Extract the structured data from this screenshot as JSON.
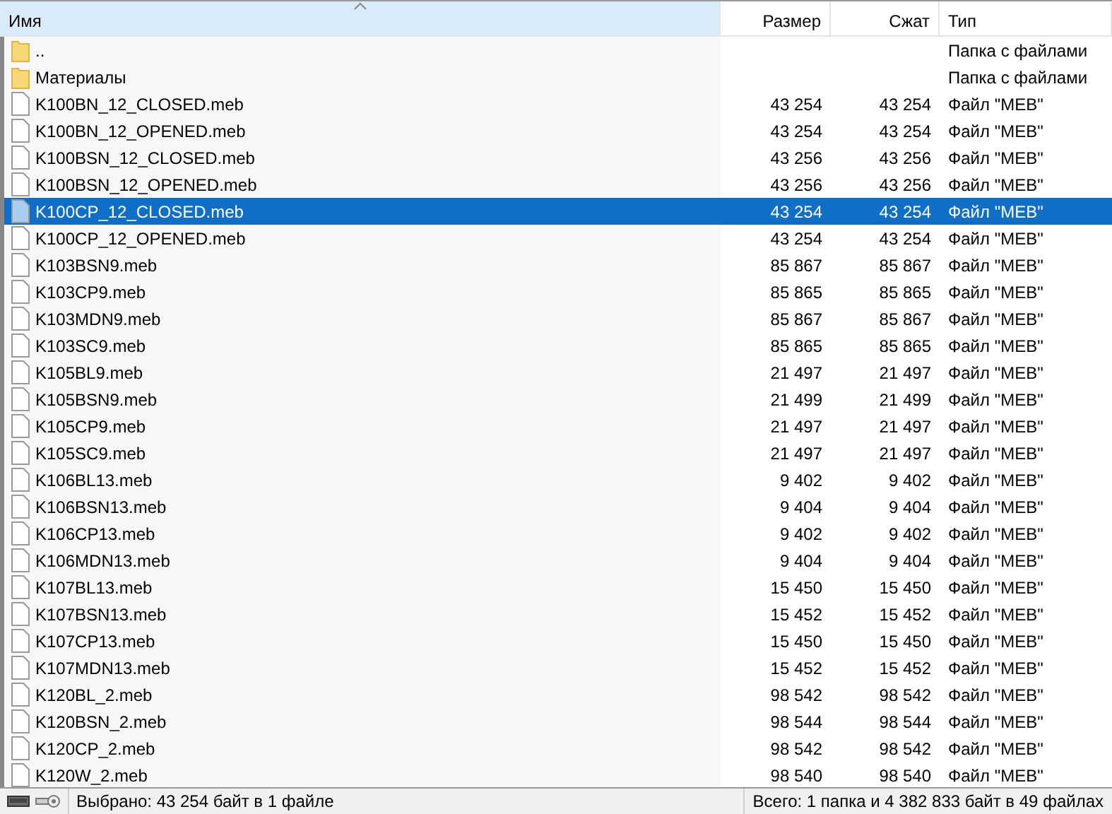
{
  "table": {
    "columns": [
      {
        "label": "Имя",
        "sorted": true,
        "kind": "text"
      },
      {
        "label": "Размер",
        "sorted": false,
        "kind": "number"
      },
      {
        "label": "Сжат",
        "sorted": false,
        "kind": "number"
      },
      {
        "label": "Тип",
        "sorted": false,
        "kind": "text"
      }
    ],
    "rows": [
      {
        "kind": "folder",
        "name": "..",
        "size": "",
        "packed": "",
        "type": "Папка с файлами",
        "selected": false
      },
      {
        "kind": "folder",
        "name": "Материалы",
        "size": "",
        "packed": "",
        "type": "Папка с файлами",
        "selected": false
      },
      {
        "kind": "file",
        "name": "K100BN_12_CLOSED.meb",
        "size": "43 254",
        "packed": "43 254",
        "type": "Файл \"MEB\"",
        "selected": false
      },
      {
        "kind": "file",
        "name": "K100BN_12_OPENED.meb",
        "size": "43 254",
        "packed": "43 254",
        "type": "Файл \"MEB\"",
        "selected": false
      },
      {
        "kind": "file",
        "name": "K100BSN_12_CLOSED.meb",
        "size": "43 256",
        "packed": "43 256",
        "type": "Файл \"MEB\"",
        "selected": false
      },
      {
        "kind": "file",
        "name": "K100BSN_12_OPENED.meb",
        "size": "43 256",
        "packed": "43 256",
        "type": "Файл \"MEB\"",
        "selected": false
      },
      {
        "kind": "file",
        "name": "K100CP_12_CLOSED.meb",
        "size": "43 254",
        "packed": "43 254",
        "type": "Файл \"MEB\"",
        "selected": true
      },
      {
        "kind": "file",
        "name": "K100CP_12_OPENED.meb",
        "size": "43 254",
        "packed": "43 254",
        "type": "Файл \"MEB\"",
        "selected": false
      },
      {
        "kind": "file",
        "name": "K103BSN9.meb",
        "size": "85 867",
        "packed": "85 867",
        "type": "Файл \"MEB\"",
        "selected": false
      },
      {
        "kind": "file",
        "name": "K103CP9.meb",
        "size": "85 865",
        "packed": "85 865",
        "type": "Файл \"MEB\"",
        "selected": false
      },
      {
        "kind": "file",
        "name": "K103MDN9.meb",
        "size": "85 867",
        "packed": "85 867",
        "type": "Файл \"MEB\"",
        "selected": false
      },
      {
        "kind": "file",
        "name": "K103SC9.meb",
        "size": "85 865",
        "packed": "85 865",
        "type": "Файл \"MEB\"",
        "selected": false
      },
      {
        "kind": "file",
        "name": "K105BL9.meb",
        "size": "21 497",
        "packed": "21 497",
        "type": "Файл \"MEB\"",
        "selected": false
      },
      {
        "kind": "file",
        "name": "K105BSN9.meb",
        "size": "21 499",
        "packed": "21 499",
        "type": "Файл \"MEB\"",
        "selected": false
      },
      {
        "kind": "file",
        "name": "K105CP9.meb",
        "size": "21 497",
        "packed": "21 497",
        "type": "Файл \"MEB\"",
        "selected": false
      },
      {
        "kind": "file",
        "name": "K105SC9.meb",
        "size": "21 497",
        "packed": "21 497",
        "type": "Файл \"MEB\"",
        "selected": false
      },
      {
        "kind": "file",
        "name": "K106BL13.meb",
        "size": "9 402",
        "packed": "9 402",
        "type": "Файл \"MEB\"",
        "selected": false
      },
      {
        "kind": "file",
        "name": "K106BSN13.meb",
        "size": "9 404",
        "packed": "9 404",
        "type": "Файл \"MEB\"",
        "selected": false
      },
      {
        "kind": "file",
        "name": "K106CP13.meb",
        "size": "9 402",
        "packed": "9 402",
        "type": "Файл \"MEB\"",
        "selected": false
      },
      {
        "kind": "file",
        "name": "K106MDN13.meb",
        "size": "9 404",
        "packed": "9 404",
        "type": "Файл \"MEB\"",
        "selected": false
      },
      {
        "kind": "file",
        "name": "K107BL13.meb",
        "size": "15 450",
        "packed": "15 450",
        "type": "Файл \"MEB\"",
        "selected": false
      },
      {
        "kind": "file",
        "name": "K107BSN13.meb",
        "size": "15 452",
        "packed": "15 452",
        "type": "Файл \"MEB\"",
        "selected": false
      },
      {
        "kind": "file",
        "name": "K107CP13.meb",
        "size": "15 450",
        "packed": "15 450",
        "type": "Файл \"MEB\"",
        "selected": false
      },
      {
        "kind": "file",
        "name": "K107MDN13.meb",
        "size": "15 452",
        "packed": "15 452",
        "type": "Файл \"MEB\"",
        "selected": false
      },
      {
        "kind": "file",
        "name": "K120BL_2.meb",
        "size": "98 542",
        "packed": "98 542",
        "type": "Файл \"MEB\"",
        "selected": false
      },
      {
        "kind": "file",
        "name": "K120BSN_2.meb",
        "size": "98 544",
        "packed": "98 544",
        "type": "Файл \"MEB\"",
        "selected": false
      },
      {
        "kind": "file",
        "name": "K120CP_2.meb",
        "size": "98 542",
        "packed": "98 542",
        "type": "Файл \"MEB\"",
        "selected": false
      },
      {
        "kind": "file",
        "name": "K120W_2.meb",
        "size": "98 540",
        "packed": "98 540",
        "type": "Файл \"MEB\"",
        "selected": false
      }
    ]
  },
  "status_bar": {
    "selection": "Выбрано: 43 254 байт в 1 файле",
    "total": "Всего: 1 папка и 4 382 833 байт в 49 файлах"
  }
}
